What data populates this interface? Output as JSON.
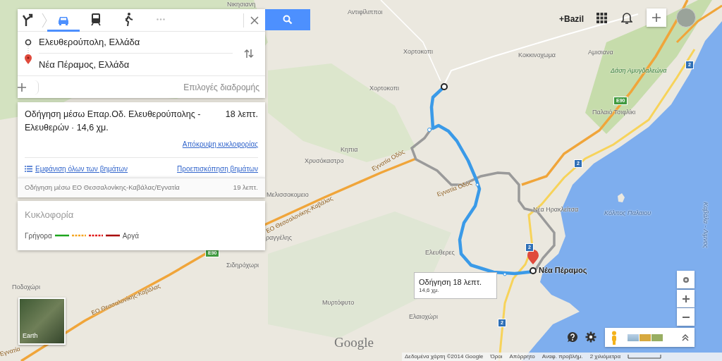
{
  "directions": {
    "modes": [
      {
        "kind": "best",
        "selected": false
      },
      {
        "kind": "car",
        "selected": true
      },
      {
        "kind": "transit",
        "selected": false
      },
      {
        "kind": "walk",
        "selected": false
      },
      {
        "kind": "more",
        "selected": false
      }
    ],
    "origin": "Ελευθερούπολη, Ελλάδα",
    "destination": "Νέα Πέραμος, Ελλάδα",
    "route_options": "Επιλογές διαδρομής"
  },
  "routes": [
    {
      "summary": "Οδήγηση μέσω Επαρ.Οδ. Ελευθερούπολης - Ελευθερών · 14,6 χμ.",
      "duration": "18 λεπτ.",
      "selected": true,
      "hide_traffic": "Απόκρυψη κυκλοφορίας",
      "show_steps": "Εμφάνιση όλων των βημάτων",
      "preview_steps": "Προεπισκόπηση βημάτων"
    },
    {
      "summary": "Οδήγηση μέσω ΕΟ Θεσσαλονίκης-Καβάλας/Εγνατία",
      "duration": "19 λεπτ.",
      "selected": false
    }
  ],
  "traffic": {
    "title": "Κυκλοφορία",
    "fast": "Γρήγορα",
    "slow": "Αργά",
    "legend": [
      {
        "kind": "solid",
        "color": "#1ea51e"
      },
      {
        "kind": "dashed",
        "color": "#f5a623"
      },
      {
        "kind": "dashed",
        "color": "#e21b1b"
      },
      {
        "kind": "solid",
        "color": "#a80000"
      }
    ]
  },
  "account": {
    "user": "+Bazil"
  },
  "map": {
    "labels": [
      {
        "text": "Νικησιανη",
        "kind": "place"
      },
      {
        "text": "Αντιφίλιπποι",
        "kind": "place"
      },
      {
        "text": "Χορτοκοπι",
        "kind": "place"
      },
      {
        "text": "Χορτοκοπι",
        "kind": "place"
      },
      {
        "text": "Κοκκινοχωμα",
        "kind": "place"
      },
      {
        "text": "Αμισιανα",
        "kind": "place"
      },
      {
        "text": "Δάση Αμυγδαλεώνα",
        "kind": "park"
      },
      {
        "text": "Παλαιό Τσιφλίκι",
        "kind": "place"
      },
      {
        "text": "Κηπια",
        "kind": "place"
      },
      {
        "text": "Χρυσόκαστρο",
        "kind": "place"
      },
      {
        "text": "Μελισσοκομειο",
        "kind": "place"
      },
      {
        "text": "ραγγέλης",
        "kind": "place"
      },
      {
        "text": "Ελευθερες",
        "kind": "place"
      },
      {
        "text": "Σιδηρόχωρι",
        "kind": "place"
      },
      {
        "text": "Ποδοχώρι",
        "kind": "place"
      },
      {
        "text": "Μυρτόφυτο",
        "kind": "place"
      },
      {
        "text": "Ελαιοχώρι",
        "kind": "place"
      },
      {
        "text": "Νέα Ηρακλείτσα",
        "kind": "place"
      },
      {
        "text": "Κόλπος Παλαιου",
        "kind": "water"
      },
      {
        "text": "Καβάλα - Λιμνος",
        "kind": "water"
      },
      {
        "text": "Εγνατία Οδός",
        "kind": "road"
      },
      {
        "text": "Εγνατία Οδός",
        "kind": "road"
      },
      {
        "text": "ΕΟ Θεσσαλονίκης-Καβάλας",
        "kind": "road"
      },
      {
        "text": "ΕΟ Θεσσαλονίκης-Καβάλας",
        "kind": "road"
      },
      {
        "text": "Εγνατία",
        "kind": "road"
      }
    ],
    "shields": [
      {
        "text": "E90",
        "kind": "euro"
      },
      {
        "text": "2",
        "kind": "national"
      },
      {
        "text": "2",
        "kind": "national"
      },
      {
        "text": "2",
        "kind": "national"
      },
      {
        "text": "2",
        "kind": "national"
      },
      {
        "text": "E90",
        "kind": "euro"
      }
    ],
    "destination_label": "Νέα Πέραμος",
    "route_popup": {
      "duration": "Οδήγηση 18 λεπτ.",
      "distance": "14,6 χμ."
    },
    "earth_label": "Earth",
    "logo": "Google"
  },
  "footer": [
    "Δεδομένα χάρτη ©2014 Google",
    "Όροι",
    "Απόρρητο",
    "Αναφ. προβλήμ.",
    "2 χιλιόμετρα"
  ]
}
